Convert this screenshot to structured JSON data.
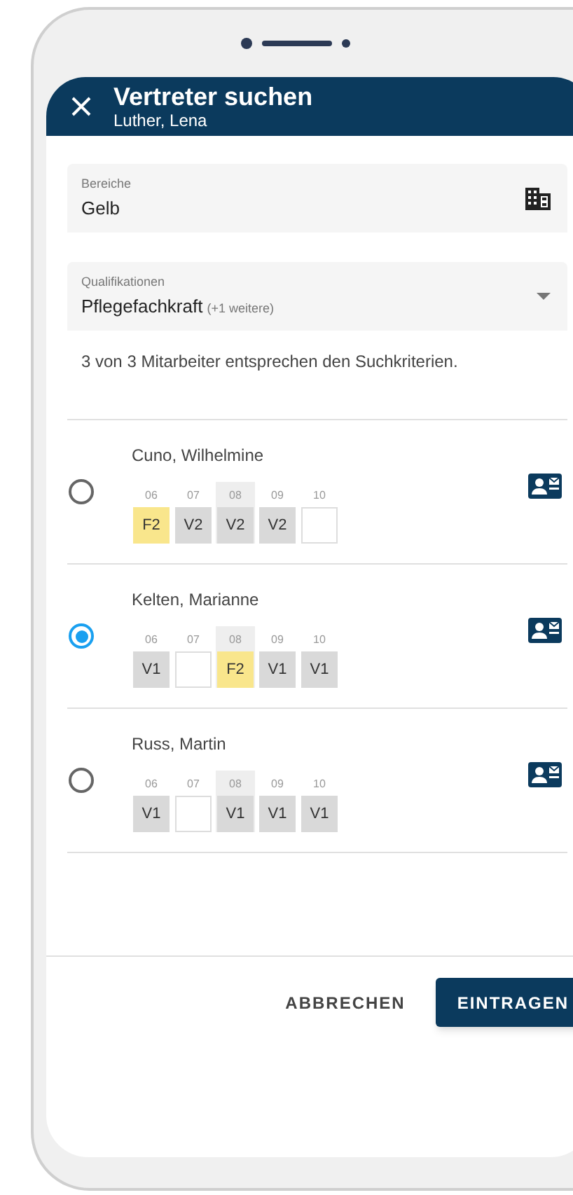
{
  "header": {
    "title": "Vertreter suchen",
    "subtitle": "Luther, Lena"
  },
  "fields": [
    {
      "kind": "building",
      "label": "Bereiche",
      "value": "Gelb"
    },
    {
      "kind": "dropdown",
      "label": "Qualifikationen",
      "value": "Pflegefachkraft",
      "extra": "(+1 weitere)"
    }
  ],
  "result_text": "3 von 3 Mitarbeiter entsprechen den Suchkriterien.",
  "employees": [
    {
      "name": "Cuno, Wilhelmine",
      "selected": false,
      "days": [
        {
          "label": "06",
          "highlighted": false,
          "kind": "free",
          "code": "F2"
        },
        {
          "label": "07",
          "highlighted": false,
          "kind": "duty",
          "code": "V2"
        },
        {
          "label": "08",
          "highlighted": true,
          "kind": "duty",
          "code": "V2"
        },
        {
          "label": "09",
          "highlighted": false,
          "kind": "duty",
          "code": "V2"
        },
        {
          "label": "10",
          "highlighted": false,
          "kind": "empty"
        }
      ]
    },
    {
      "name": "Kelten, Marianne",
      "selected": true,
      "days": [
        {
          "label": "06",
          "highlighted": false,
          "kind": "duty",
          "code": "V1"
        },
        {
          "label": "07",
          "highlighted": false,
          "kind": "empty"
        },
        {
          "label": "08",
          "highlighted": true,
          "kind": "free",
          "code": "F2"
        },
        {
          "label": "09",
          "highlighted": false,
          "kind": "duty",
          "code": "V1"
        },
        {
          "label": "10",
          "highlighted": false,
          "kind": "duty",
          "code": "V1"
        }
      ]
    },
    {
      "name": "Russ, Martin",
      "selected": false,
      "days": [
        {
          "label": "06",
          "highlighted": false,
          "kind": "duty",
          "code": "V1"
        },
        {
          "label": "07",
          "highlighted": false,
          "kind": "empty"
        },
        {
          "label": "08",
          "highlighted": true,
          "kind": "duty",
          "code": "V1"
        },
        {
          "label": "09",
          "highlighted": false,
          "kind": "duty",
          "code": "V1"
        },
        {
          "label": "10",
          "highlighted": false,
          "kind": "duty",
          "code": "V1"
        }
      ]
    }
  ],
  "buttons": [
    {
      "kind": "text",
      "label": "ABBRECHEN"
    },
    {
      "kind": "primary",
      "label": "EINTRAGEN"
    }
  ]
}
